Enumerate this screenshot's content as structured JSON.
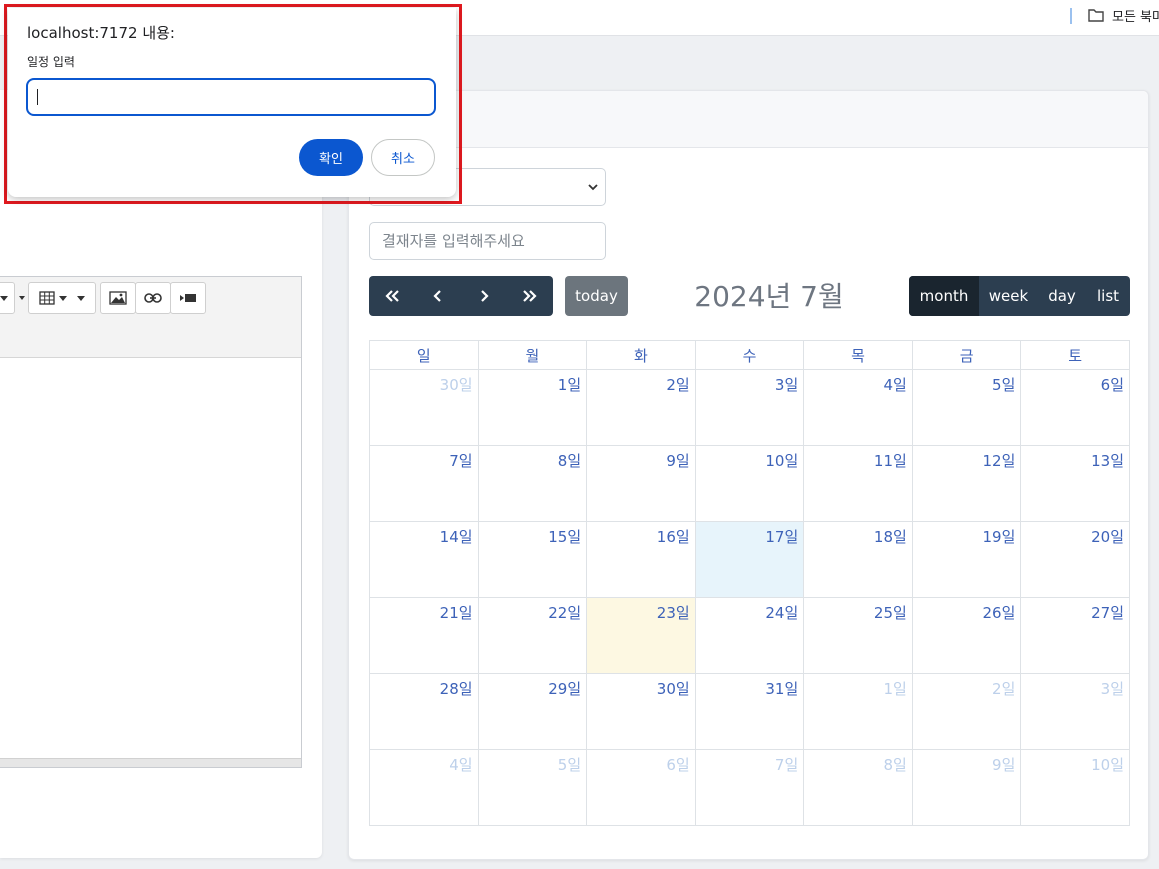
{
  "bookmarks_bar": {
    "folder_icon": "folder-icon",
    "all_bookmarks_label": "모든 북마"
  },
  "editor": {
    "toolbar_icons": [
      "dropdown-caret-icon",
      "table-icon",
      "image-icon",
      "link-icon",
      "video-icon"
    ]
  },
  "calendar_panel": {
    "approver_placeholder": "결재자를 입력해주세요",
    "nav": {
      "prev_year": "«",
      "prev": "‹",
      "next": "›",
      "next_year": "»",
      "today": "today"
    },
    "title": "2024년 7월",
    "views": [
      "month",
      "week",
      "day",
      "list"
    ],
    "active_view": "month",
    "weekdays": [
      "일",
      "월",
      "화",
      "수",
      "목",
      "금",
      "토"
    ],
    "weeks": [
      [
        "30일",
        "1일",
        "2일",
        "3일",
        "4일",
        "5일",
        "6일"
      ],
      [
        "7일",
        "8일",
        "9일",
        "10일",
        "11일",
        "12일",
        "13일"
      ],
      [
        "14일",
        "15일",
        "16일",
        "17일",
        "18일",
        "19일",
        "20일"
      ],
      [
        "21일",
        "22일",
        "23일",
        "24일",
        "25일",
        "26일",
        "27일"
      ],
      [
        "28일",
        "29일",
        "30일",
        "31일",
        "1일",
        "2일",
        "3일"
      ],
      [
        "4일",
        "5일",
        "6일",
        "7일",
        "8일",
        "9일",
        "10일"
      ]
    ],
    "other_month_cells": [
      "0-0",
      "4-4",
      "4-5",
      "4-6",
      "5-0",
      "5-1",
      "5-2",
      "5-3",
      "5-4",
      "5-5",
      "5-6"
    ],
    "highlighted_cell": "2-3",
    "today_cell": "3-2",
    "colors": {
      "date_text": "#3d62b8",
      "other_month_text": "#bdd0ea",
      "highlight_bg": "#e7f4fb",
      "today_bg": "#fdf8e2",
      "button_dark": "#2c3e50"
    }
  },
  "dialog": {
    "title": "localhost:7172 내용:",
    "message": "일정 입력",
    "input_value": "",
    "ok_label": "확인",
    "cancel_label": "취소",
    "accent_color": "#0b57d0",
    "frame_color": "#e0191f"
  }
}
